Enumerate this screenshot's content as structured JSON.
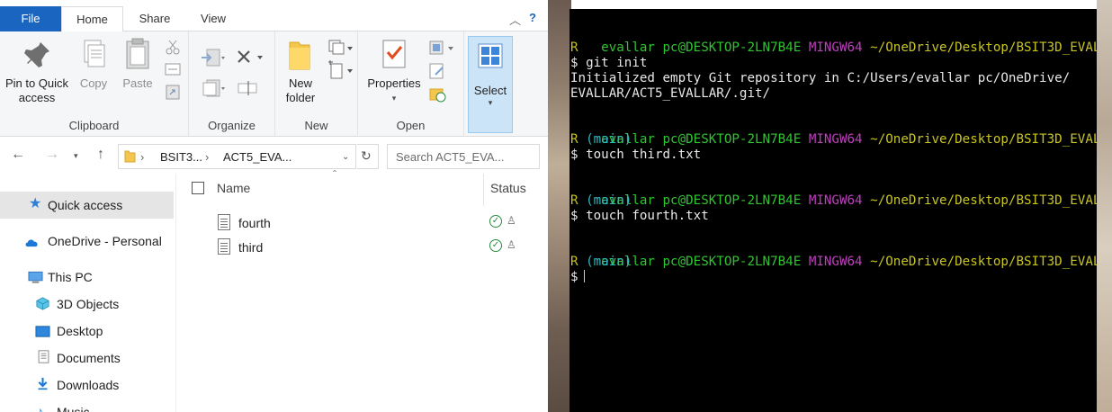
{
  "explorer": {
    "tabs": {
      "file": "File",
      "home": "Home",
      "share": "Share",
      "view": "View"
    },
    "ribbon": {
      "pin_label": "Pin to Quick access",
      "copy_label": "Copy",
      "paste_label": "Paste",
      "clipboard_label": "Clipboard",
      "organize_label": "Organize",
      "new_folder_label": "New folder",
      "new_label": "New",
      "properties_label": "Properties",
      "open_label": "Open",
      "select_label": "Select"
    },
    "breadcrumbs": [
      "BSIT3...",
      "ACT5_EVA..."
    ],
    "search_placeholder": "Search ACT5_EVA...",
    "nav": {
      "quick_access": "Quick access",
      "onedrive": "OneDrive - Personal",
      "this_pc": "This PC",
      "objects_3d": "3D Objects",
      "desktop": "Desktop",
      "documents": "Documents",
      "downloads": "Downloads",
      "music": "Music"
    },
    "columns": {
      "name": "Name",
      "status": "Status"
    },
    "files": [
      {
        "name": "fourth"
      },
      {
        "name": "third"
      }
    ]
  },
  "terminal": {
    "user_host": "evallar pc@DESKTOP-2LN7B4E",
    "shell": "MINGW64",
    "path_line1": "~/OneDrive/Desktop/BSIT3D_EVAL",
    "path_line2": "R",
    "branch": "(main)",
    "cmd1": "$ git init",
    "out1a": "Initialized empty Git repository in C:/Users/evallar pc/OneDrive/",
    "out1b": "EVALLAR/ACT5_EVALLAR/.git/",
    "cmd2": "$ touch third.txt",
    "cmd3": "$ touch fourth.txt",
    "prompt": "$"
  },
  "colors": {
    "file_tab": "#1a65c0",
    "prompt_green": "#31c431",
    "shell_purple": "#bf3fbf",
    "path_yellow": "#c8c422",
    "branch_cyan": "#2fb8c2"
  }
}
